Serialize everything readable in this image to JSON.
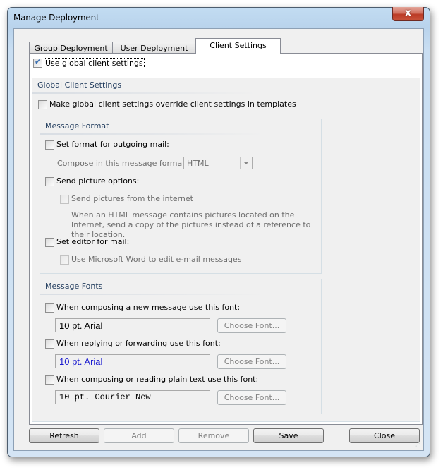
{
  "window": {
    "title": "Manage Deployment",
    "close_icon": "close-icon"
  },
  "tabs": [
    {
      "label": "Group Deployment",
      "active": false
    },
    {
      "label": "User Deployment",
      "active": false
    },
    {
      "label": "Client Settings",
      "active": true
    }
  ],
  "use_global": {
    "label": "Use global client settings",
    "checked": true
  },
  "global_group": {
    "title": "Global Client Settings",
    "override": {
      "label": "Make global client settings override client settings in templates",
      "checked": false
    }
  },
  "message_format": {
    "title": "Message Format",
    "set_format": {
      "label": "Set format for outgoing mail:",
      "checked": false
    },
    "compose_label": "Compose in this message format:",
    "compose_value": "HTML",
    "send_picture": {
      "label": "Send picture options:",
      "checked": false
    },
    "send_internet": {
      "label": "Send pictures from the internet",
      "checked": false
    },
    "description": "When an HTML message contains pictures located on the Internet, send a copy of the pictures instead of a reference to their location.",
    "set_editor": {
      "label": "Set editor for mail:",
      "checked": false
    },
    "use_word": {
      "label": "Use Microsoft Word to edit e-mail messages",
      "checked": false
    }
  },
  "message_fonts": {
    "title": "Message Fonts",
    "rows": [
      {
        "label": "When composing a new message use this font:",
        "checked": false,
        "value": "10 pt. Arial",
        "color": "#000000",
        "button": "Choose Font..."
      },
      {
        "label": "When replying or forwarding use this font:",
        "checked": false,
        "value": "10 pt. Arial",
        "color": "#1a1ad0",
        "button": "Choose Font..."
      },
      {
        "label": "When composing or reading plain text use this font:",
        "checked": false,
        "value": "10 pt. Courier New",
        "color": "#000000",
        "button": "Choose Font..."
      }
    ]
  },
  "buttons": {
    "refresh": "Refresh",
    "add": "Add",
    "remove": "Remove",
    "save": "Save",
    "close": "Close"
  }
}
